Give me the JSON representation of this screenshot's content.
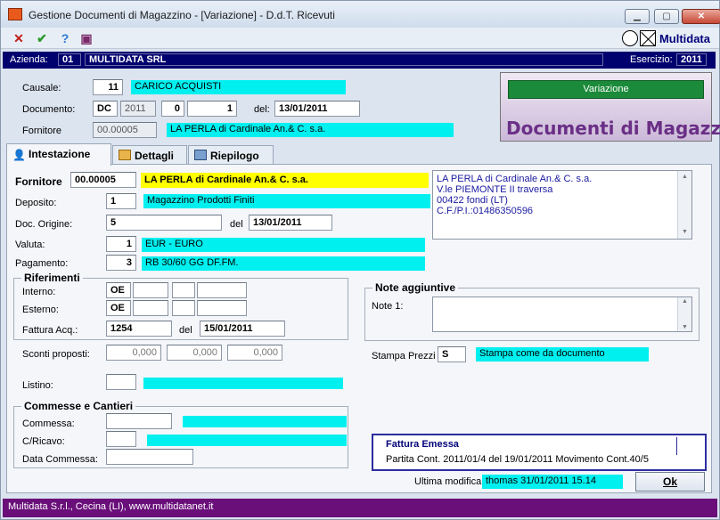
{
  "window": {
    "title": "Gestione Documenti di Magazzino - [Variazione] - D.d.T. Ricevuti",
    "min": "▁",
    "max": "▢",
    "close": "✕"
  },
  "toolbar": {
    "logo_text": "Multidata"
  },
  "azienda": {
    "label": "Azienda:",
    "code": "01",
    "name": "MULTIDATA SRL",
    "esercizio_label": "Esercizio:",
    "esercizio": "2011"
  },
  "header": {
    "causale_label": "Causale:",
    "causale_code": "11",
    "causale_desc": "CARICO ACQUISTI",
    "documento_label": "Documento:",
    "doc_type": "DC",
    "doc_year": "2011",
    "doc_serie": "0",
    "doc_num": "1",
    "del_label": "del:",
    "doc_date": "13/01/2011",
    "fornitore_label": "Fornitore",
    "fornitore_code": "00.00005",
    "fornitore_desc": "LA PERLA di Cardinale An.& C. s.a."
  },
  "banner": {
    "button": "Variazione",
    "title": "Documenti di Magazzino"
  },
  "tabs": [
    {
      "label": "Intestazione"
    },
    {
      "label": "Dettagli"
    },
    {
      "label": "Riepilogo"
    }
  ],
  "intest": {
    "fornitore_label": "Fornitore",
    "fornitore_code": "00.00005",
    "fornitore_name": "LA PERLA di Cardinale An.& C. s.a.",
    "address": [
      "LA PERLA di Cardinale An.& C. s.a.",
      "V.le PIEMONTE II traversa",
      "00422 fondi (LT)",
      "C.F./P.I.:01486350596"
    ],
    "deposito_label": "Deposito:",
    "deposito_code": "1",
    "deposito_desc": "Magazzino Prodotti Finiti",
    "docorig_label": "Doc. Origine:",
    "docorig_num": "5",
    "docorig_del": "del",
    "docorig_date": "13/01/2011",
    "valuta_label": "Valuta:",
    "valuta_code": "1",
    "valuta_desc": "EUR - EURO",
    "pagamento_label": "Pagamento:",
    "pagamento_code": "3",
    "pagamento_desc": "RB 30/60 GG DF.FM.",
    "riferimenti_title": "Riferimenti",
    "interno_label": "Interno:",
    "interno_code": "OE",
    "esterno_label": "Esterno:",
    "esterno_code": "OE",
    "fattura_label": "Fattura Acq.:",
    "fattura_num": "1254",
    "fattura_del": "del",
    "fattura_date": "15/01/2011",
    "sconti_label": "Sconti proposti:",
    "sconti": [
      "0,000",
      "0,000",
      "0,000"
    ],
    "listino_label": "Listino:",
    "commesse_title": "Commesse e Cantieri",
    "commessa_label": "Commessa:",
    "cricavo_label": "C/Ricavo:",
    "datacommessa_label": "Data Commessa:",
    "note_title": "Note aggiuntive",
    "note1_label": "Note 1:",
    "stampa_label": "Stampa Prezzi",
    "stampa_code": "S",
    "stampa_desc": "Stampa come da documento",
    "fattura_box_title": "Fattura Emessa",
    "fattura_box_text": "Partita Cont. 2011/01/4 del 19/01/2011    Movimento Cont.40/5",
    "ultima_label": "Ultima modifica",
    "ultima_value": "thomas 31/01/2011 15.14",
    "ok": "Ok"
  },
  "statusbar": "Multidata S.r.l., Cecina (LI), www.multidatanet.it"
}
